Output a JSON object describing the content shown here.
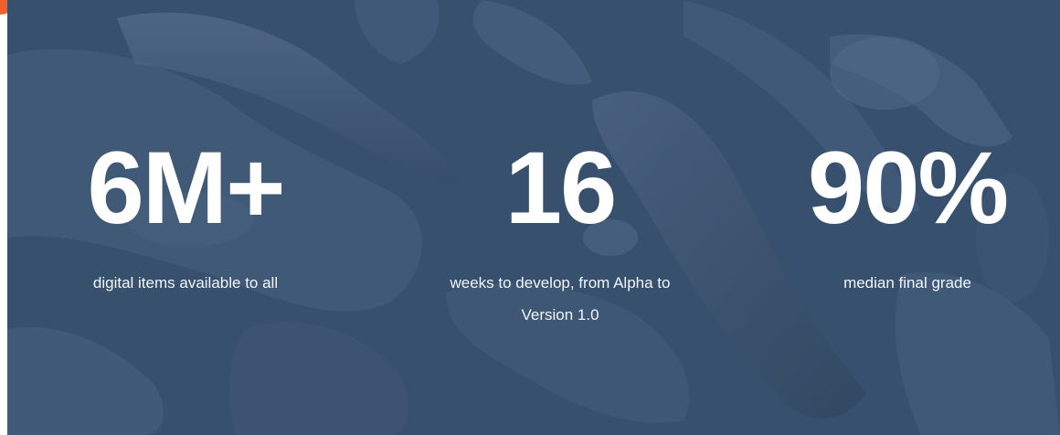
{
  "stats": [
    {
      "number": "6M+",
      "caption": "digital items available to all"
    },
    {
      "number": "16",
      "caption_line1": "weeks to develop, from Alpha to",
      "caption_line2": "Version 1.0"
    },
    {
      "number": "90%",
      "caption": "median final grade"
    }
  ],
  "colors": {
    "overlay": "#3d5673",
    "text": "#ffffff",
    "badge": "#f0612a"
  }
}
